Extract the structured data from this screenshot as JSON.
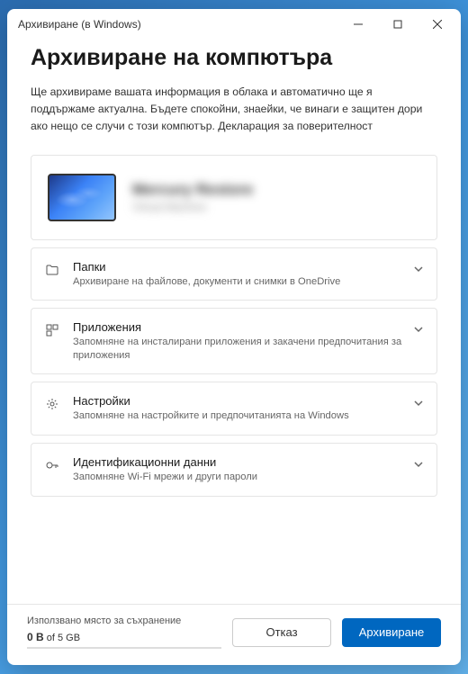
{
  "window": {
    "title": "Архивиране (в Windows)"
  },
  "header": {
    "title": "Архивиране на компютъра",
    "description": "Ще архивираме вашата информация в облака и автоматично ще я поддържаме актуална. Бъдете спокойни, знаейки, че винаги е защитен дори ако нещо се случи с този компютър. ",
    "privacy_link": "Декларация за поверителност"
  },
  "device": {
    "name": "Mercury Restore",
    "subtitle": "Virtual Machine"
  },
  "sections": [
    {
      "icon": "folder",
      "title": "Папки",
      "desc": "Архивиране на файлове, документи и снимки в OneDrive"
    },
    {
      "icon": "apps",
      "title": "Приложения",
      "desc": "Запомняне на инсталирани приложения и закачени предпочитания за приложения"
    },
    {
      "icon": "settings",
      "title": "Настройки",
      "desc": "Запомняне на настройките и предпочитанията на Windows"
    },
    {
      "icon": "key",
      "title": "Идентификационни данни",
      "desc": "Запомняне Wi-Fi мрежи и други пароли"
    }
  ],
  "footer": {
    "storage_label": "Използвано място за съхранение",
    "used": "0 B",
    "of": "of",
    "total": "5 GB",
    "cancel": "Отказ",
    "confirm": "Архивиране"
  }
}
